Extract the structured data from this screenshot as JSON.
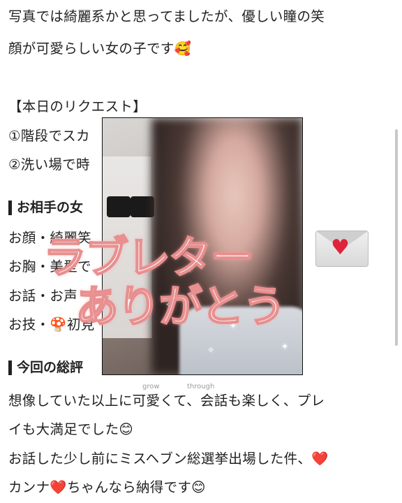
{
  "article": {
    "lines": [
      "写真では綺麗系かと思ってましたが、優しい瞳の笑",
      "顔が可愛らしい女の子です🥰",
      "【本日のリクエスト】",
      "①階段でスカ",
      "②洗い場で時",
      "お顔・綺麗笑",
      "お胸・美型で",
      "お話・お声",
      "お技・🍄初見",
      "想像していた以上に可愛くて、会話も楽しく、プレ",
      "イも大満足でした😊",
      "お話した少し前にミスヘブン総選挙出場した件、❤️",
      "カンナ❤️ちゃんなら納得です😊"
    ],
    "headings": [
      "お相手の女",
      "今回の総評"
    ]
  },
  "story": {
    "title_line1": "ラブレター",
    "title_line2": "ありがとう",
    "watermark_1": "grow",
    "watermark_2": "through"
  },
  "colors": {
    "text": "#222222",
    "title_fill": "#ffffff",
    "title_outline": "#e88f8f",
    "heart": "#e0223a"
  },
  "icons": [
    "envelope-icon",
    "heart-icon",
    "sparkle-icon"
  ]
}
